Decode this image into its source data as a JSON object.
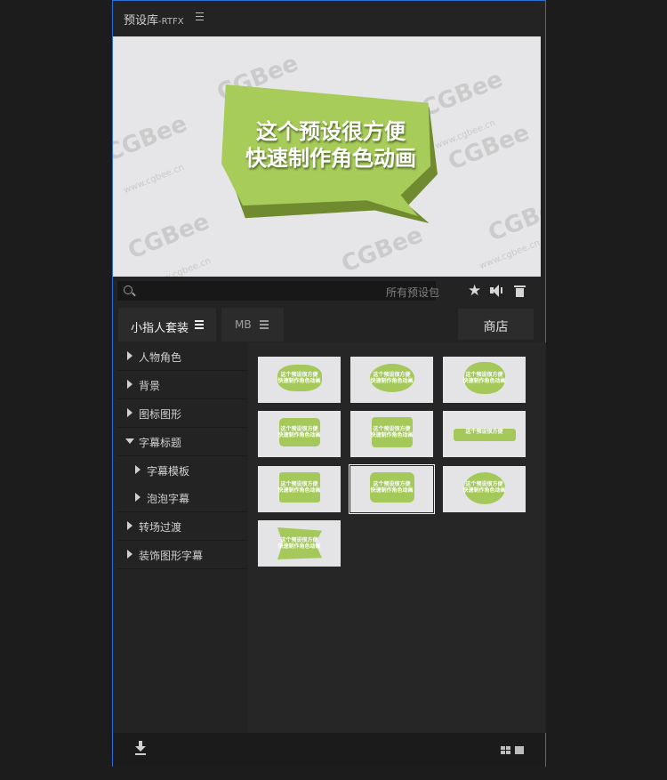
{
  "window": {
    "title": "预设库",
    "title_suffix": "-RTFX"
  },
  "preview": {
    "line1": "这个预设很方便",
    "line2": "快速制作角色动画",
    "watermark": "CGBee",
    "watermark_url": "www.cgbee.cn"
  },
  "search": {
    "placeholder": "所有预设包"
  },
  "toolbar": {
    "favorite_icon": "star-icon",
    "sound_icon": "speaker-icon",
    "delete_icon": "trash-icon"
  },
  "tabs": [
    {
      "label": "小指人套装",
      "active": true
    },
    {
      "label": "MB",
      "active": false
    }
  ],
  "shop_label": "商店",
  "tree": [
    {
      "label": "人物角色",
      "expanded": false,
      "level": 0
    },
    {
      "label": "背景",
      "expanded": false,
      "level": 0
    },
    {
      "label": "图标图形",
      "expanded": false,
      "level": 0
    },
    {
      "label": "字幕标题",
      "expanded": true,
      "level": 0
    },
    {
      "label": "字幕模板",
      "expanded": false,
      "level": 1
    },
    {
      "label": "泡泡字幕",
      "expanded": false,
      "level": 1
    },
    {
      "label": "转场过渡",
      "expanded": false,
      "level": 0
    },
    {
      "label": "装饰图形字幕",
      "expanded": false,
      "level": 0
    }
  ],
  "thumb_text": {
    "line1": "这个预设很方便",
    "line2": "快速制作角色动画"
  },
  "thumbnails_count": 10,
  "selected_thumbnail": 8,
  "colors": {
    "accent_border": "#2d6fd6",
    "bubble_green": "#a7cc5a",
    "panel_bg": "#232323"
  },
  "bottom": {
    "download_icon": "download-icon",
    "view_grid_icon": "grid-view-icon",
    "view_large_icon": "large-view-icon"
  }
}
